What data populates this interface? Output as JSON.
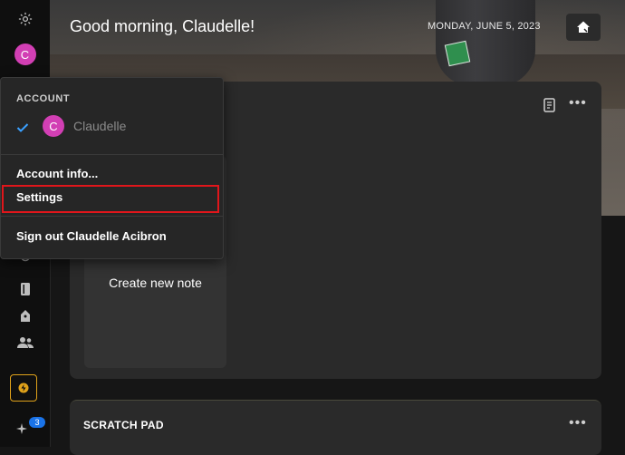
{
  "sidebar": {
    "avatar_initial": "C",
    "badge_count": "3"
  },
  "hero": {
    "greeting": "Good morning, Claudelle!",
    "date": "MONDAY, JUNE 5, 2023"
  },
  "account_menu": {
    "header": "ACCOUNT",
    "user_initial": "C",
    "user_name": "Claudelle",
    "items": [
      {
        "label": "Account info..."
      },
      {
        "label": "Settings"
      },
      {
        "label": "Sign out Claudelle Acibron"
      }
    ]
  },
  "notes": {
    "create_label": "Create new note"
  },
  "scratch_pad": {
    "title": "SCRATCH PAD"
  },
  "colors": {
    "accent_green": "#1f9e4c",
    "avatar_pink": "#d23fb4",
    "highlight_red": "#e0161b",
    "check_blue": "#3aa0ff"
  }
}
